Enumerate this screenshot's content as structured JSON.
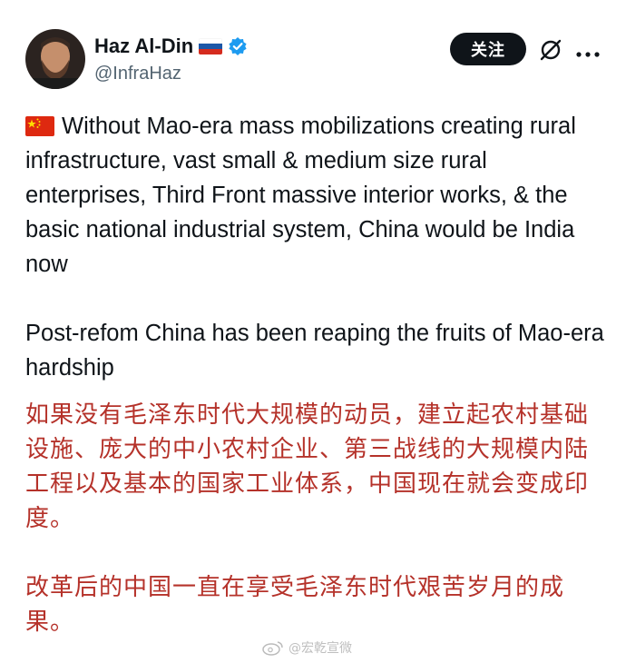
{
  "author": {
    "display_name": "Haz Al-Din",
    "handle": "@InfraHaz",
    "country_flag_icon": "russia-flag-icon",
    "verified_icon": "verified-badge-icon",
    "verified_color": "#1d9bf0"
  },
  "actions": {
    "follow_label": "关注",
    "grok_icon": "grok-icon",
    "more_icon": "more-options-icon"
  },
  "tweet": {
    "inline_flag_icon": "china-flag-icon",
    "paragraph1": "Without Mao-era mass mobilizations creating rural infrastructure, vast small & medium size rural enterprises, Third Front massive interior works, & the basic national industrial system, China would be India now",
    "paragraph2": "Post-refom China has been reaping the fruits of Mao-era hardship"
  },
  "translation": {
    "color": "#b5322a",
    "paragraph1": "如果没有毛泽东时代大规模的动员，建立起农村基础设施、庞大的中小农村企业、第三战线的大规模内陆工程以及基本的国家工业体系，中国现在就会变成印度。",
    "paragraph2": "改革后的中国一直在享受毛泽东时代艰苦岁月的成果。"
  },
  "watermark": {
    "icon": "weibo-icon",
    "text": "@宏乾宣微"
  }
}
